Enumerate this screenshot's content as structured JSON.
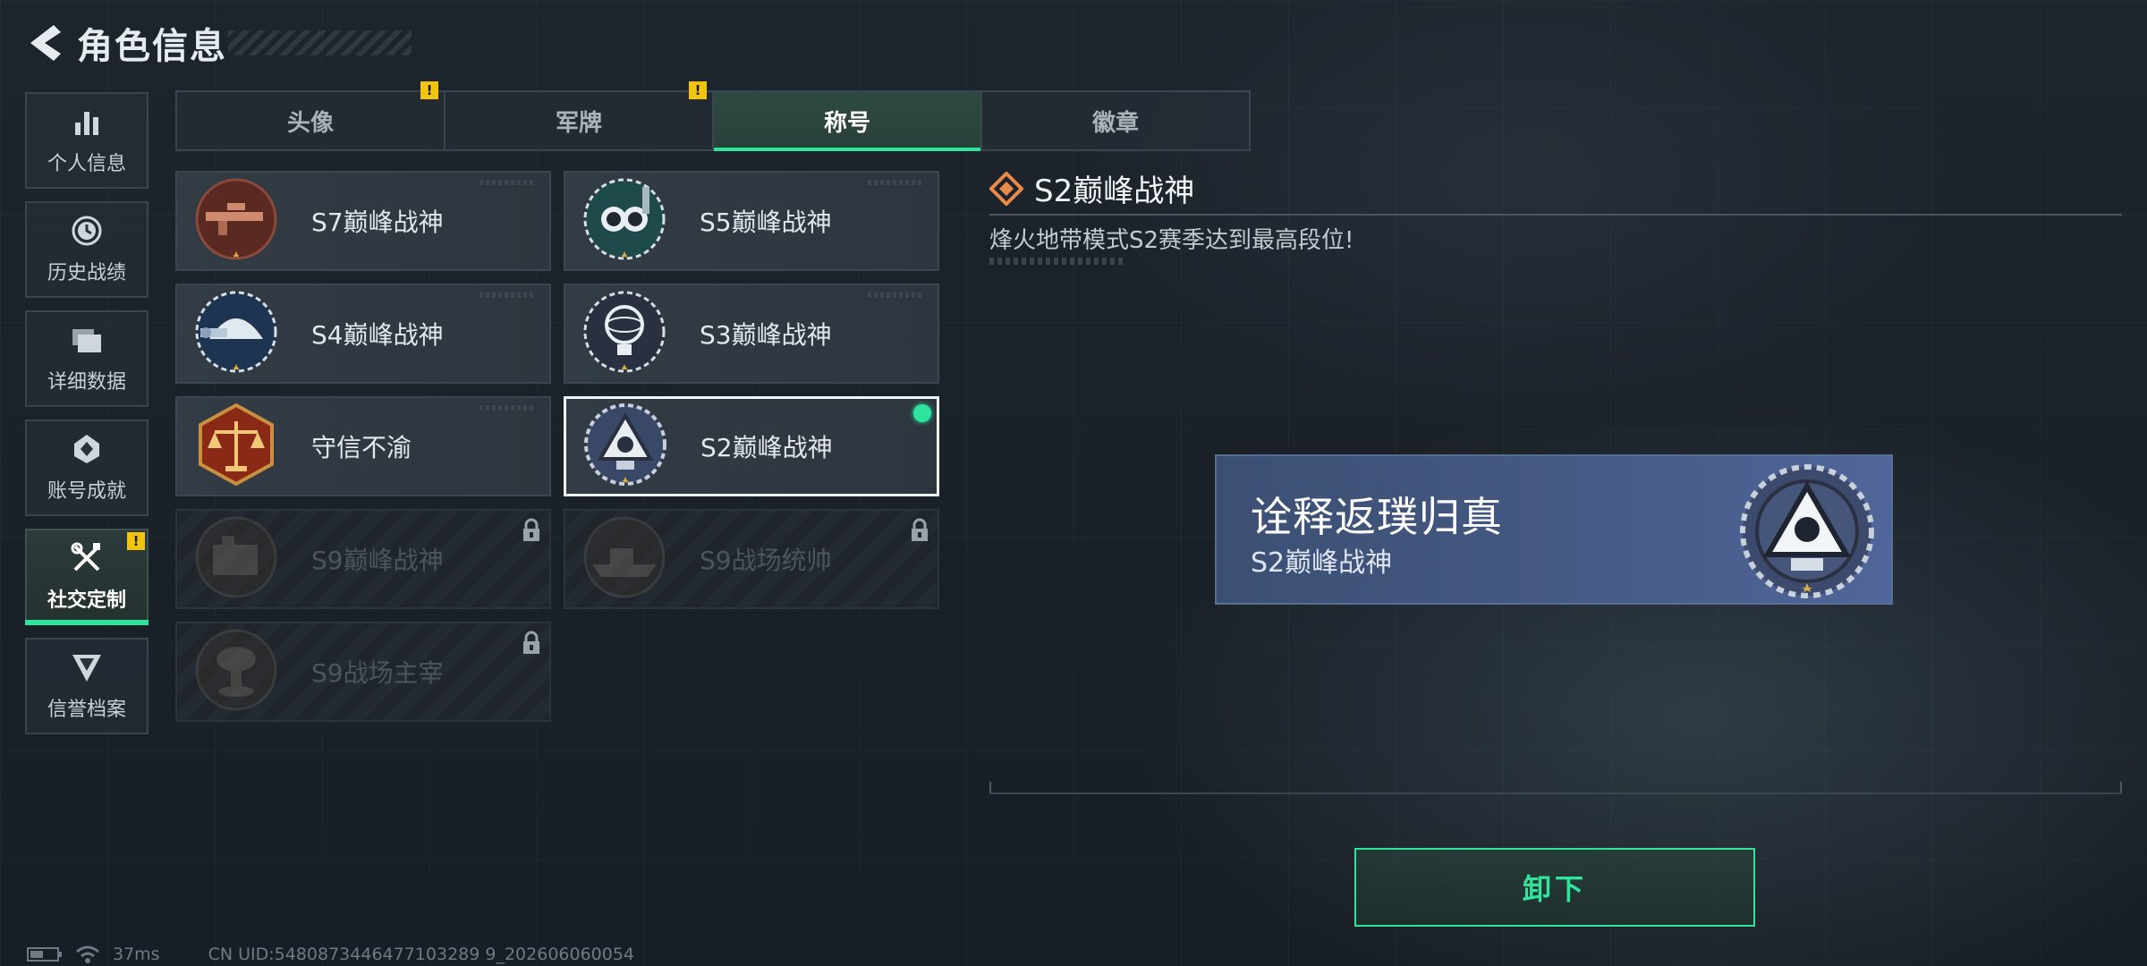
{
  "header": {
    "title": "角色信息"
  },
  "sidebar": {
    "items": [
      {
        "label": "个人信息",
        "icon": "bar-chart-icon"
      },
      {
        "label": "历史战绩",
        "icon": "clock-icon"
      },
      {
        "label": "详细数据",
        "icon": "folders-icon"
      },
      {
        "label": "账号成就",
        "icon": "achievement-icon"
      },
      {
        "label": "社交定制",
        "icon": "tools-icon",
        "active": true,
        "badge": "!"
      },
      {
        "label": "信誉档案",
        "icon": "shield-v-icon"
      }
    ]
  },
  "tabs": [
    {
      "label": "头像",
      "badge": "!"
    },
    {
      "label": "军牌",
      "badge": "!"
    },
    {
      "label": "称号",
      "active": true
    },
    {
      "label": "徽章"
    }
  ],
  "titles": [
    {
      "label": "S7巅峰战神",
      "emblem": "sniper-rifle-emblem",
      "locked": false
    },
    {
      "label": "S5巅峰战神",
      "emblem": "diver-mask-emblem",
      "locked": false
    },
    {
      "label": "S4巅峰战神",
      "emblem": "helmet-emblem",
      "locked": false
    },
    {
      "label": "S3巅峰战神",
      "emblem": "globe-trophy-emblem",
      "locked": false
    },
    {
      "label": "守信不渝",
      "emblem": "scales-emblem",
      "locked": false
    },
    {
      "label": "S2巅峰战神",
      "emblem": "triangle-r-emblem",
      "locked": false,
      "selected": true,
      "equipped": true
    },
    {
      "label": "S9巅峰战神",
      "emblem": "building-emblem",
      "locked": true
    },
    {
      "label": "S9战场统帅",
      "emblem": "warship-emblem",
      "locked": true
    },
    {
      "label": "S9战场主宰",
      "emblem": "mushroom-cloud-emblem",
      "locked": true
    }
  ],
  "detail": {
    "title": "S2巅峰战神",
    "description": "烽火地带模式S2赛季达到最高段位!",
    "banner": {
      "name": "诠释返璞归真",
      "title": "S2巅峰战神"
    }
  },
  "actions": {
    "unequip_label": "卸下"
  },
  "status": {
    "ping": "37ms",
    "uid": "CN UID:5480873446477103289 9_202606060054"
  },
  "colors": {
    "accent": "#2ee59d",
    "warning": "#f1c40f",
    "banner": "#455a84"
  }
}
